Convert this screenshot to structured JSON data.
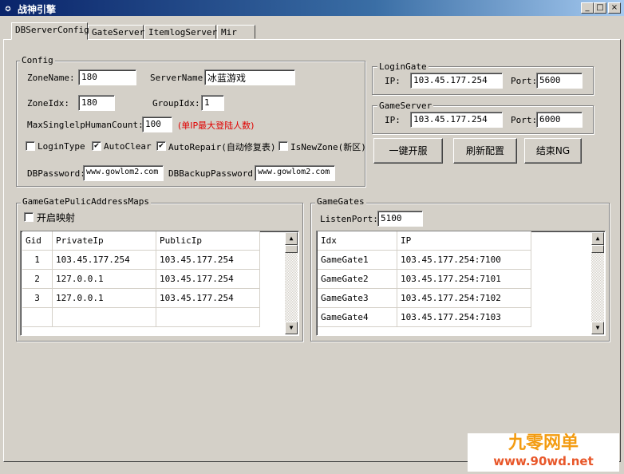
{
  "window": {
    "title": "战神引擎",
    "icon": "app-icon"
  },
  "tabs": [
    {
      "label": "DBServerConfig",
      "active": true
    },
    {
      "label": "GateServer",
      "active": false
    },
    {
      "label": "ItemlogServer",
      "active": false
    },
    {
      "label": "Mir",
      "active": false
    }
  ],
  "config": {
    "group_label": "Config",
    "zone_name_label": "ZoneName:",
    "zone_name_value": "180",
    "server_name_label": "ServerName:",
    "server_name_value": "冰蓝游戏",
    "zone_idx_label": "ZoneIdx:",
    "zone_idx_value": "180",
    "group_idx_label": "GroupIdx:",
    "group_idx_value": "1",
    "max_human_label": "MaxSinglelpHumanCount:",
    "max_human_value": "100",
    "max_human_note": "(单IP最大登陆人数)",
    "login_type_label": "LoginType",
    "login_type_checked": false,
    "auto_clear_label": "AutoClear",
    "auto_clear_checked": true,
    "auto_repair_label": "AutoRepair(自动修复表)",
    "auto_repair_checked": true,
    "is_new_zone_label": "IsNewZone(新区)",
    "is_new_zone_checked": false,
    "db_password_label": "DBPassword:",
    "db_password_value": "www.gowlom2.com",
    "db_backup_password_label": "DBBackupPassword:",
    "db_backup_password_value": "www.gowlom2.com"
  },
  "login_gate": {
    "group_label": "LoginGate",
    "ip_label": "IP:",
    "ip_value": "103.45.177.254",
    "port_label": "Port:",
    "port_value": "5600"
  },
  "game_server": {
    "group_label": "GameServer",
    "ip_label": "IP:",
    "ip_value": "103.45.177.254",
    "port_label": "Port:",
    "port_value": "6000"
  },
  "actions": {
    "one_click_start": "一键开服",
    "refresh_config": "刷新配置",
    "stop_ng": "结束NG"
  },
  "public_maps": {
    "group_label": "GameGatePulicAddressMaps",
    "enable_label": "开启映射",
    "enable_checked": false,
    "columns": [
      "Gid",
      "PrivateIp",
      "PublicIp"
    ],
    "rows": [
      [
        "1",
        "103.45.177.254",
        "103.45.177.254"
      ],
      [
        "2",
        "127.0.0.1",
        "103.45.177.254"
      ],
      [
        "3",
        "127.0.0.1",
        "103.45.177.254"
      ]
    ]
  },
  "game_gates": {
    "group_label": "GameGates",
    "listen_port_label": "ListenPort:",
    "listen_port_value": "5100",
    "columns": [
      "Idx",
      "IP"
    ],
    "rows": [
      [
        "GameGate1",
        "103.45.177.254:7100"
      ],
      [
        "GameGate2",
        "103.45.177.254:7101"
      ],
      [
        "GameGate3",
        "103.45.177.254:7102"
      ],
      [
        "GameGate4",
        "103.45.177.254:7103"
      ]
    ]
  },
  "watermark": {
    "brand": "九零网单",
    "url": "www.90wd.net"
  }
}
